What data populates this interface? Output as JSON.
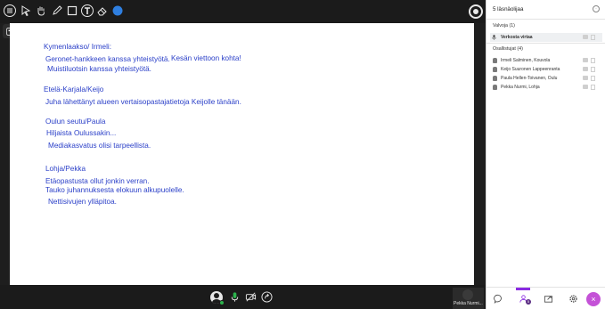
{
  "whiteboard": {
    "lines": [
      "Kymenlaakso/ Irmeli:",
      "Geronet-hankkeen kanssa yhteistyötä.",
      "Kesän viettoon kohta!",
      "Muistiluotsin kanssa yhteistyötä.",
      "Etelä-Karjala/Keijo",
      "Juha lähettänyt alueen vertaisopastajatietoja Keijolle tänään.",
      "Oulun seutu/Paula",
      "Hiljaista Oulussakin...",
      "Mediakasvatus olisi tarpeellista.",
      "Lohja/Pekka",
      "Etäopastusta ollut jonkin verran.",
      "Tauko juhannuksesta elokuun alkupuolelle.",
      "Nettisivujen ylläpitoa."
    ]
  },
  "self_tile": {
    "name": "Pekka Nurmi..."
  },
  "panel": {
    "header": "5 läsnäolijaa",
    "moderators_title": "Valvoja (1)",
    "moderators": [
      {
        "name": "Verkosta virtaa"
      }
    ],
    "participants_title": "Osallistujat (4)",
    "participants": [
      {
        "name": "Irmeli Salminen, Kouvola"
      },
      {
        "name": "Keijo Suuronen Lappeenranta"
      },
      {
        "name": "Paula Hellen-Toivanen, Oulu"
      },
      {
        "name": "Pekka Nurmi, Lohja"
      }
    ],
    "attendees_badge": "5"
  },
  "colors": {
    "accent": "#8a2be2",
    "ink": "#2a3fc8",
    "leave": "#c452d7"
  },
  "icons": [
    "menu-icon",
    "pointer-icon",
    "hand-icon",
    "pencil-icon",
    "rectangle-icon",
    "text-icon",
    "eraser-icon",
    "color-icon",
    "record-icon",
    "mic-icon",
    "video-off-icon",
    "share-icon",
    "chat-icon",
    "attendees-icon",
    "share-content-icon",
    "settings-icon",
    "close-icon"
  ]
}
